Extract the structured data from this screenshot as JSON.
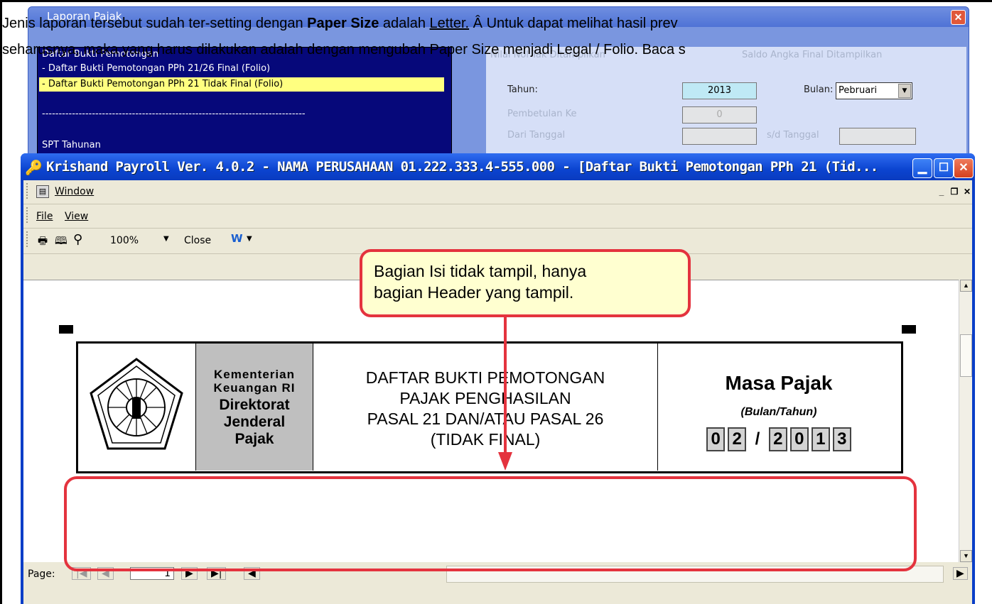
{
  "overlay": {
    "line1_pre": "Jenis laporan tersebut sudah ter-setting dengan ",
    "line1_bold": "Paper Size",
    "line1_mid": " adalah ",
    "line1_link": "Letter.",
    "line1_post": " Â  Untuk dapat melihat hasil prev",
    "line2": "seharusnya, maka yang harus dilakukan adalah dengan mengubah Paper Size menjadi Legal / Folio. Baca s"
  },
  "bg_window": {
    "title": "Laporan Pajak",
    "list_items": [
      "Daftar Bukti Pemotongan",
      "- Daftar Bukti Pemotongan PPh 21/26 Final  (Folio)",
      "- Daftar Bukti Pemotongan PPh 21 Tidak Final  (Folio)",
      "-------------------------------------------------------------------------------",
      "SPT Tahunan"
    ],
    "form": {
      "nihil_label": "Nilai Nol Tak Ditampilkan",
      "saldo_label": "Saldo Angka Final Ditampilkan",
      "tahun_label": "Tahun:",
      "tahun_value": "2013",
      "bulan_label": "Bulan:",
      "bulan_value": "Pebruari",
      "pembetulan_label": "Pembetulan Ke",
      "pembetulan_value": "0",
      "dari_label": "Dari Tanggal",
      "sd_label": "s/d Tanggal"
    }
  },
  "main_window": {
    "title": "Krishand Payroll Ver. 4.0.2 - NAMA PERUSAHAAN 01.222.333.4-555.000 - [Daftar Bukti Pemotongan PPh 21 (Tid...",
    "menu1": "Window",
    "menu_file": "File",
    "menu_view": "View",
    "zoom": "100%",
    "close_label": "Close",
    "page_label": "Page:",
    "page_value": "1"
  },
  "report_header": {
    "org1": "Kementerian",
    "org2": "Keuangan RI",
    "org3": "Direktorat",
    "org4": "Jenderal",
    "org5": "Pajak",
    "title1": "DAFTAR BUKTI PEMOTONGAN",
    "title2": "PAJAK PENGHASILAN",
    "title3": "PASAL 21 DAN/ATAU PASAL 26",
    "title4": "(TIDAK FINAL)",
    "masa_title": "Masa Pajak",
    "masa_sub": "(Bulan/Tahun)",
    "month_digits": [
      "0",
      "2"
    ],
    "sep": "/",
    "year_digits": [
      "2",
      "0",
      "1",
      "3"
    ]
  },
  "callout": {
    "line1": "Bagian Isi tidak tampil, hanya",
    "line2": "bagian Header yang tampil."
  },
  "colors": {
    "accent_red": "#e4333e",
    "callout_fill": "#ffffd0",
    "xp_blue": "#0a3ec8"
  }
}
